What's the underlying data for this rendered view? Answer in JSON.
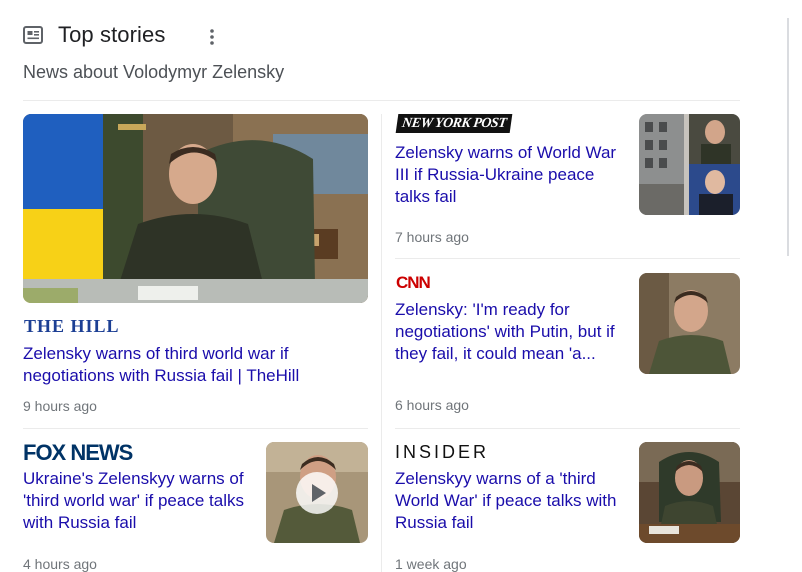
{
  "top_crop_text": "",
  "section": {
    "title": "Top stories",
    "subtitle": "News about Volodymyr Zelensky",
    "icon": "newspaper-icon",
    "menu_icon": "more-vert-icon"
  },
  "stories": [
    {
      "source": "THE HILL",
      "headline": "Zelensky warns of third world war if negotiations with Russia fail | TheHill",
      "time": "9 hours ago",
      "image": "zelensky-at-desk-with-ukrainian-flag"
    },
    {
      "source": "NEW YORK POST",
      "headline": "Zelensky warns of World War III if Russia-Ukraine peace talks fail",
      "time": "7 hours ago",
      "image": "collage-damaged-building-zelensky-putin"
    },
    {
      "source": "CNN",
      "headline": "Zelensky: 'I'm ready for negotiations' with Putin, but if they fail, it could mean 'a...",
      "time": "6 hours ago",
      "image": "zelensky-portrait"
    },
    {
      "source": "FOX NEWS",
      "headline": "Ukraine's Zelenskyy warns of 'third world war' if peace talks with Russia fail",
      "time": "4 hours ago",
      "image": "zelensky-video",
      "has_video": true
    },
    {
      "source": "INSIDER",
      "headline": "Zelenskyy warns of a 'third World War' if peace talks with Russia fail",
      "time": "1 week ago",
      "image": "zelensky-seated-at-desk"
    }
  ],
  "colors": {
    "link": "#1a0dab",
    "meta": "#70757a",
    "flag_blue": "#1f5fbf",
    "flag_yellow": "#f7d117"
  }
}
